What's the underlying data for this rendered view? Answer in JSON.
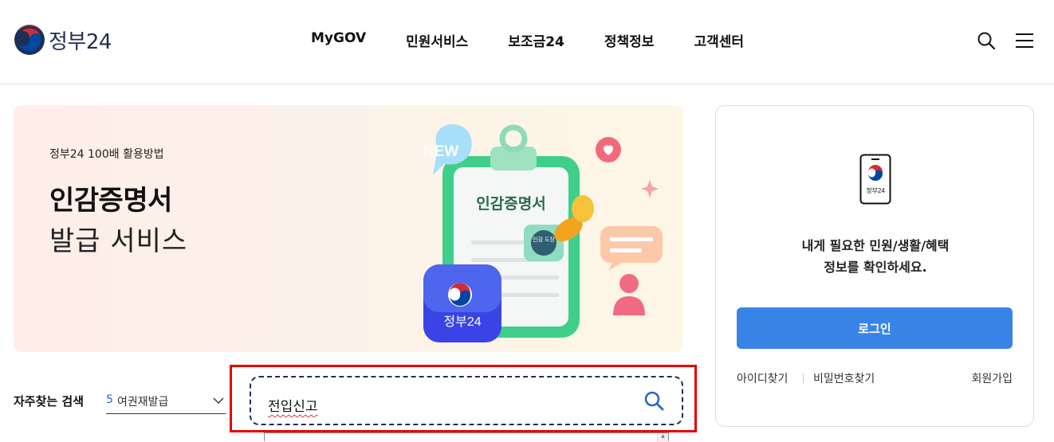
{
  "header": {
    "logo_text": "정부24",
    "nav": [
      "MyGOV",
      "민원서비스",
      "보조금24",
      "정책정보",
      "고객센터"
    ],
    "icons": [
      "search-icon",
      "menu-icon"
    ]
  },
  "banner": {
    "kicker": "정부24 100배 활용방법",
    "title": "인감증명서",
    "subtitle": "발급 서비스",
    "art": {
      "badge": "NEW",
      "clipboard_title": "인감증명서",
      "stamp_text": "인감 도장",
      "app_label": "정부24"
    }
  },
  "search": {
    "freq_label": "자주찾는 검색",
    "freq_rank": "5",
    "freq_item": "여권재발급",
    "value": "전입신고"
  },
  "login_card": {
    "app_label": "정부24",
    "message_line1": "내게 필요한 민원/생활/혜택",
    "message_line2": "정보를 확인하세요.",
    "login_button": "로그인",
    "find_id": "아이디찾기",
    "find_password": "비밀번호찾기",
    "signup": "회원가입"
  },
  "colors": {
    "accent": "#3884e6",
    "highlight_border": "#e60000",
    "brand_navy": "#1d2f55",
    "emblem_red": "#cd2e3a",
    "emblem_blue": "#0047a0"
  }
}
